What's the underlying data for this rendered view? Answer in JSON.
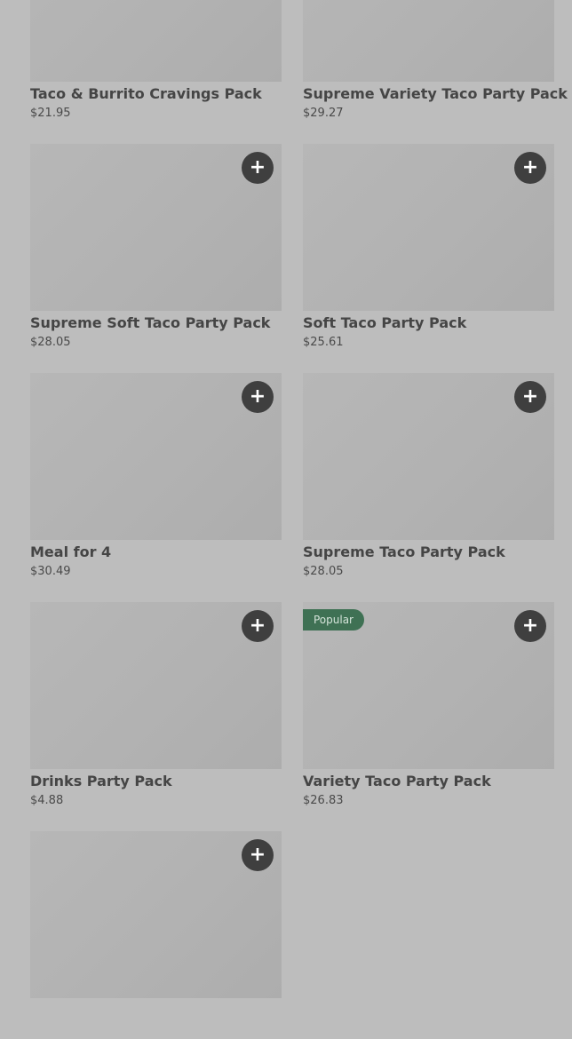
{
  "products": [
    {
      "name": "Taco & Burrito Cravings Pack",
      "price": "$21.95"
    },
    {
      "name": "Supreme Variety Taco Party Pack",
      "price": "$29.27"
    },
    {
      "name": "Supreme Soft Taco Party Pack",
      "price": "$28.05"
    },
    {
      "name": "Soft Taco Party Pack",
      "price": "$25.61"
    },
    {
      "name": "Meal for 4",
      "price": "$30.49"
    },
    {
      "name": "Supreme Taco Party Pack",
      "price": "$28.05"
    },
    {
      "name": "Drinks Party Pack",
      "price": "$4.88"
    },
    {
      "name": "Variety Taco Party Pack",
      "price": "$26.83",
      "badge": "Popular"
    },
    {
      "name": "",
      "price": ""
    }
  ],
  "icons": {
    "add": "+"
  },
  "colors": {
    "background": "#bdbdbd",
    "add_button": "#3f3f3f",
    "badge": "#3f7154"
  }
}
